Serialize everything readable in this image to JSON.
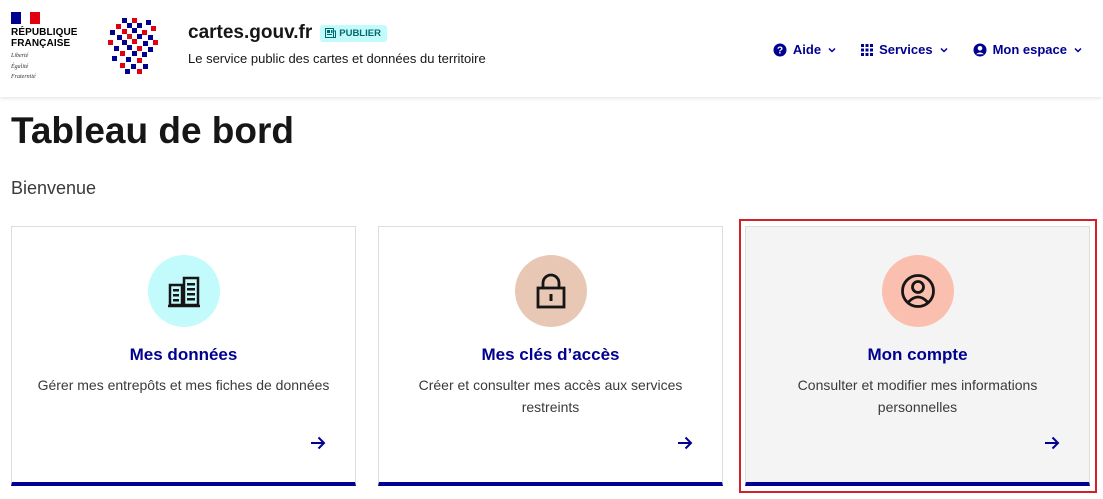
{
  "header": {
    "republic_line1": "RÉPUBLIQUE",
    "republic_line2": "FRANÇAISE",
    "motto_1": "Liberté",
    "motto_2": "Égalité",
    "motto_3": "Fraternité",
    "site_title": "cartes.gouv.fr",
    "badge_label": "PUBLIER",
    "tagline": "Le service public des cartes et données du territoire"
  },
  "nav": {
    "aide": "Aide",
    "services": "Services",
    "mon_espace": "Mon espace"
  },
  "main": {
    "title": "Tableau de bord",
    "welcome": "Bienvenue",
    "cards": [
      {
        "title": "Mes données",
        "description": "Gérer mes entrepôts et mes fiches de données",
        "icon": "building-data-icon",
        "icon_bg": "#c3fafc"
      },
      {
        "title": "Mes clés d’accès",
        "description": "Créer et consulter mes accès aux services restreints",
        "icon": "lock-icon",
        "icon_bg": "#e8c8b5"
      },
      {
        "title": "Mon compte",
        "description": "Consulter et modifier mes informations personnelles",
        "icon": "user-circle-icon",
        "icon_bg": "#fbbfb0"
      }
    ]
  },
  "colors": {
    "accent": "#000091",
    "highlight": "#d32029"
  }
}
